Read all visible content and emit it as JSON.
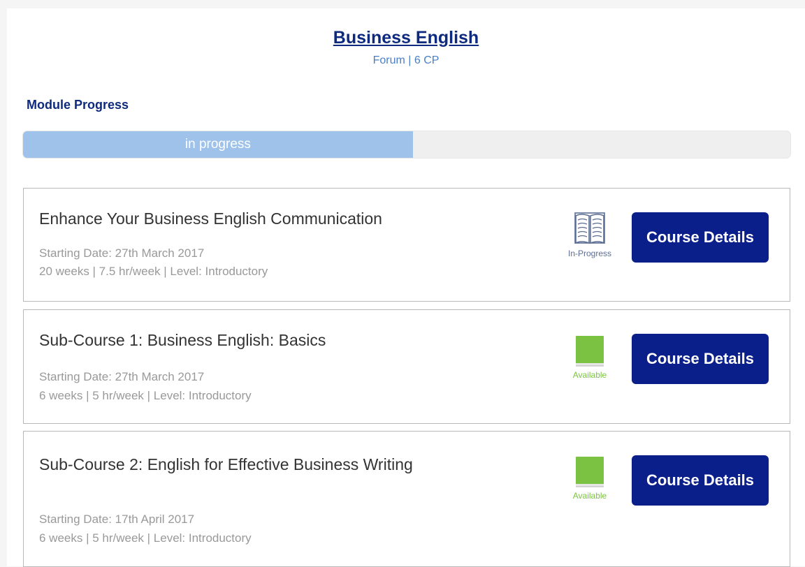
{
  "module": {
    "title": "Business English",
    "subtitle": "Forum | 6 CP"
  },
  "progress": {
    "heading": "Module Progress",
    "label": "in progress",
    "fraction": 0.508,
    "fill_color": "#9ec2ea",
    "track_color": "#efefef"
  },
  "colors": {
    "primary": "#0d2a7e",
    "button": "#0b1f8a",
    "available": "#7cc242",
    "in_progress": "#5c6d94"
  },
  "courses": [
    {
      "title": "Enhance Your Business English Communication",
      "starting_date": "Starting Date: 27th March 2017",
      "details": "20 weeks | 7.5 hr/week | Level: Introductory",
      "status": "In-Progress",
      "status_icon": "open-book-icon",
      "button_label": "Course Details"
    },
    {
      "title": "Sub-Course 1: Business English: Basics",
      "starting_date": "Starting Date: 27th March 2017",
      "details": "6 weeks | 5 hr/week | Level: Introductory",
      "status": "Available",
      "status_icon": "closed-book-icon",
      "button_label": "Course Details"
    },
    {
      "title": "Sub-Course 2: English for Effective Business Writing",
      "starting_date": "Starting Date: 17th April 2017",
      "details": "6 weeks | 5 hr/week | Level: Introductory",
      "status": "Available",
      "status_icon": "closed-book-icon",
      "button_label": "Course Details"
    }
  ]
}
